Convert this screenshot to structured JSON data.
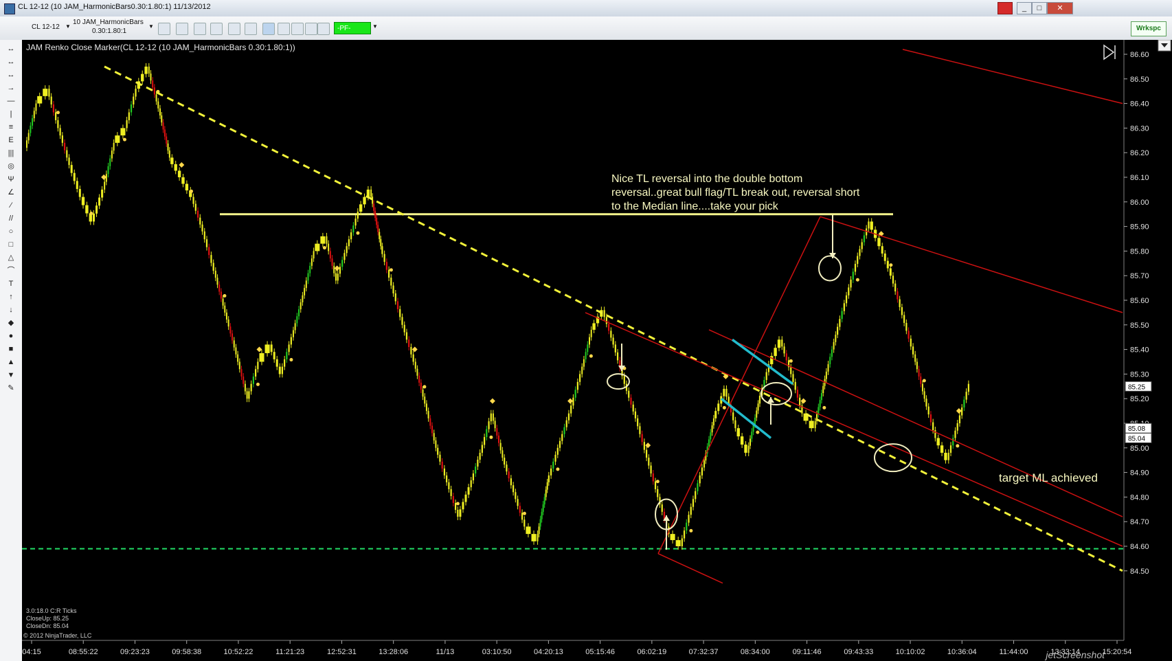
{
  "window": {
    "title": "CL 12-12 (10 JAM_HarmonicBars0.30:1.80:1)  11/13/2012",
    "buttons": [
      "_",
      "□",
      "✕"
    ]
  },
  "toolbar": {
    "instrument": "CL 12-12",
    "bartype_line1": "10 JAM_HarmonicBars",
    "bartype_line2": "0.30:1.80:1",
    "pf_label": "-PF-",
    "workspace_label": "Wrkspc"
  },
  "left_tools": [
    "↔",
    "↔",
    "↔",
    "→",
    "—",
    "|",
    "≡",
    "E",
    "|||",
    "◎",
    "Ψ",
    "∠",
    "⁄",
    "//",
    "○",
    "□",
    "△",
    "⌒",
    "T",
    "↑",
    "↓",
    "◆",
    "●",
    "■",
    "▲",
    "▼",
    "✎"
  ],
  "chart": {
    "indicator_title": "JAM Renko Close Marker(CL 12-12 (10 JAM_HarmonicBars 0.30:1.80:1))",
    "price_ticks": [
      "86.60",
      "86.50",
      "86.40",
      "86.30",
      "86.20",
      "86.10",
      "86.00",
      "85.90",
      "85.80",
      "85.70",
      "85.60",
      "85.50",
      "85.40",
      "85.30",
      "85.20",
      "85.10",
      "85.00",
      "84.90",
      "84.80",
      "84.70",
      "84.60",
      "84.50"
    ],
    "price_tags": [
      {
        "label": "85.25",
        "value": 85.25
      },
      {
        "label": "85.08",
        "value": 85.08
      },
      {
        "label": "85.04",
        "value": 85.04
      }
    ],
    "time_ticks": [
      "04:15",
      "08:55:22",
      "09:23:23",
      "09:58:38",
      "10:52:22",
      "11:21:23",
      "12:52:31",
      "13:28:06",
      "11/13",
      "03:10:50",
      "04:20:13",
      "05:15:46",
      "06:02:19",
      "07:32:37",
      "08:34:00",
      "09:11:46",
      "09:43:33",
      "10:10:02",
      "10:36:04",
      "11:44:00",
      "13:33:14",
      "15:20:54"
    ],
    "annotations": {
      "note_line1": "Nice TL reversal into the double bottom",
      "note_line2": "reversal..great bull flag/TL break out, reversal short",
      "note_line3": "to the Median line....take your pick",
      "target_note": "target ML achieved"
    },
    "info": {
      "line1": "3.0:18.0 C:R Ticks",
      "line2": "CloseUp: 85.25",
      "line3": "CloseDn: 85.04"
    },
    "copyright": "© 2012 NinjaTrader, LLC",
    "watermark": "jetScreenshot",
    "colors": {
      "background": "#000000",
      "bull_bar": "#22cc22",
      "bear_bar": "#dd1111",
      "neutral_bar": "#eeee22",
      "trendline": "#f2f23a",
      "resistance": "#f5f58c",
      "support_line": "#22dd66",
      "pitchfork": "#cc1111",
      "flag": "#22bbcc",
      "marker": "#ffd84a"
    }
  },
  "chart_data": {
    "type": "line",
    "title": "JAM Renko Close Marker(CL 12-12 (10 JAM_HarmonicBars 0.30:1.80:1))",
    "xlabel": "",
    "ylabel": "",
    "ylim": [
      84.45,
      86.65
    ],
    "x_ticks": [
      "04:15",
      "08:55:22",
      "09:23:23",
      "09:58:38",
      "10:52:22",
      "11:21:23",
      "12:52:31",
      "13:28:06",
      "11/13",
      "03:10:50",
      "04:20:13",
      "05:15:46",
      "06:02:19",
      "07:32:37",
      "08:34:00",
      "09:11:46",
      "09:43:33",
      "10:10:02",
      "10:36:04",
      "11:44:00",
      "13:33:14",
      "15:20:54"
    ],
    "series": [
      {
        "values": [
          86.22,
          86.4,
          86.46,
          86.3,
          86.15,
          86.02,
          85.92,
          86.05,
          86.24,
          86.3,
          86.46,
          86.55,
          86.38,
          86.18,
          86.1,
          86.02,
          85.88,
          85.72,
          85.55,
          85.38,
          85.2,
          85.35,
          85.42,
          85.3,
          85.45,
          85.62,
          85.8,
          85.86,
          85.68,
          85.82,
          85.96,
          86.05,
          85.82,
          85.66,
          85.5,
          85.35,
          85.18,
          85.0,
          84.86,
          84.72,
          84.84,
          84.98,
          85.14,
          84.96,
          84.82,
          84.68,
          84.62,
          84.86,
          85.0,
          85.14,
          85.3,
          85.48,
          85.56,
          85.42,
          85.26,
          85.12,
          84.96,
          84.8,
          84.65,
          84.6,
          84.76,
          84.92,
          85.12,
          85.24,
          85.08,
          84.98,
          85.18,
          85.34,
          85.44,
          85.3,
          85.14,
          85.08,
          85.28,
          85.46,
          85.62,
          85.78,
          85.92,
          85.82,
          85.7,
          85.54,
          85.38,
          85.2,
          85.04,
          84.95,
          85.1,
          85.26
        ]
      }
    ],
    "reference_lines": [
      {
        "value": 85.95
      },
      {
        "value": 84.59
      }
    ]
  }
}
